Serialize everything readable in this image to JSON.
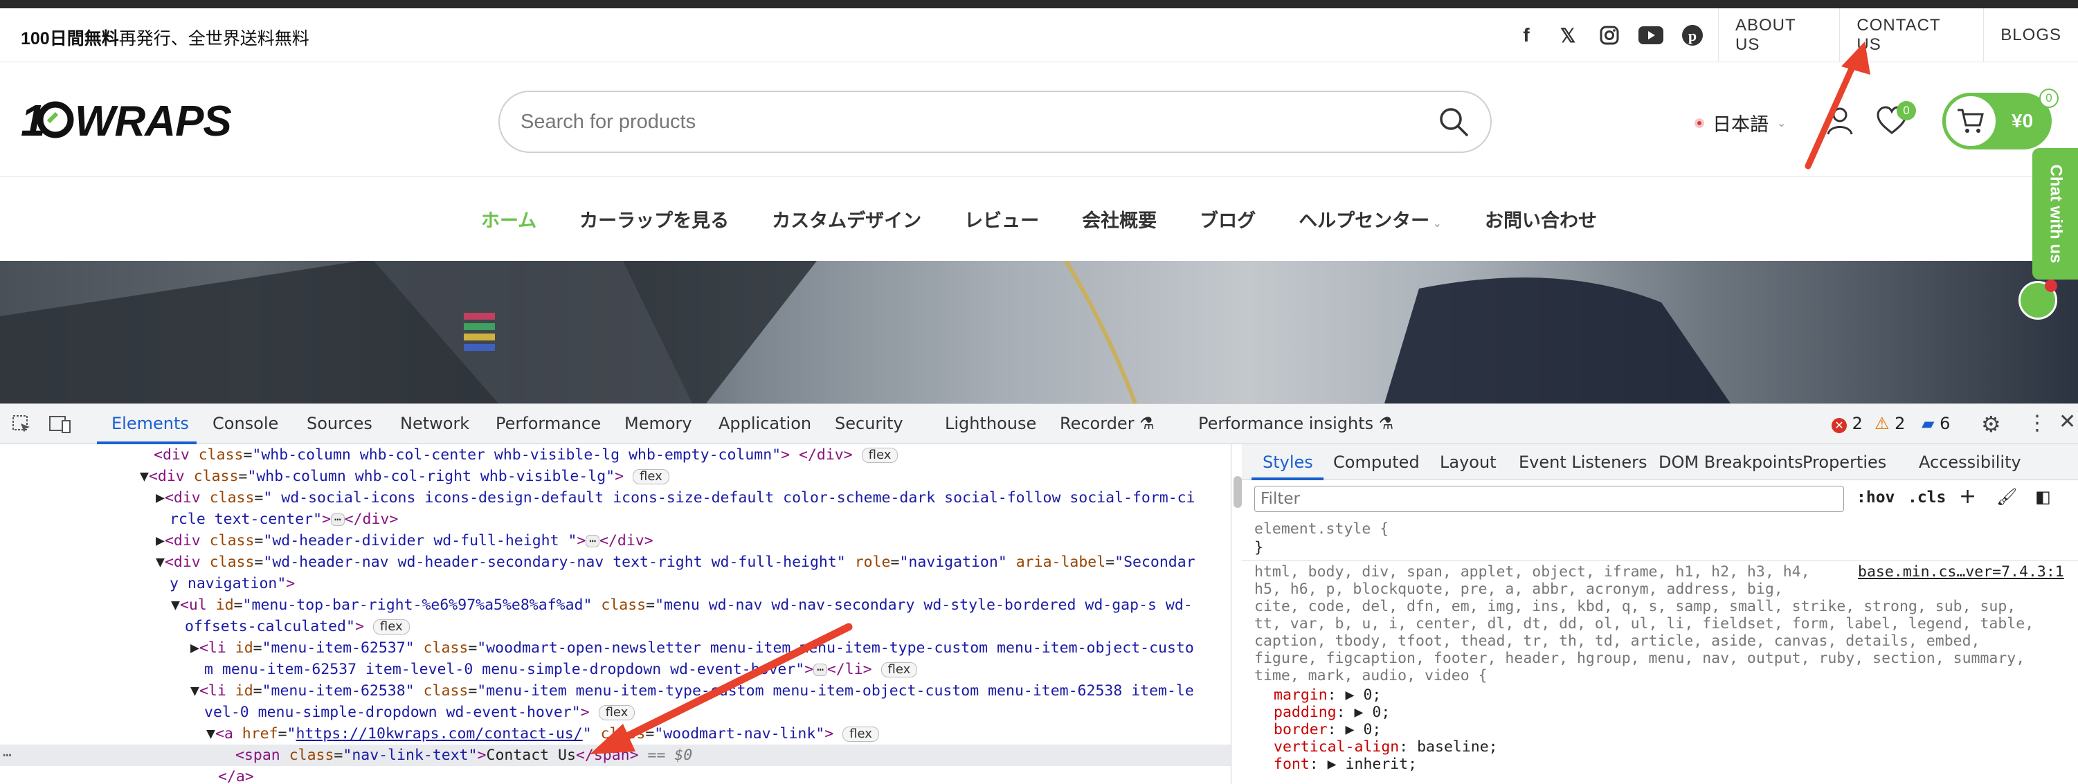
{
  "topbar": {
    "promo_bold": "100日間無料",
    "promo_rest": "再発行、全世界送料無料",
    "nav": [
      "ABOUT US",
      "CONTACT US",
      "BLOGS"
    ],
    "social_icons": [
      "facebook-icon",
      "x-icon",
      "instagram-icon",
      "youtube-icon",
      "pinterest-icon"
    ]
  },
  "header": {
    "logo_text": "10KWRAPS",
    "search_placeholder": "Search for products",
    "language": "日本語",
    "wishlist_count": "0",
    "cart_count": "0",
    "cart_amount": "¥0"
  },
  "mainnav": {
    "items": [
      "ホーム",
      "カーラップを見る",
      "カスタムデザイン",
      "レビュー",
      "会社概要",
      "ブログ",
      "ヘルプセンター",
      "お問い合わせ"
    ],
    "active_index": 0
  },
  "chat": {
    "label": "Chat with us"
  },
  "devtools": {
    "tabs": [
      "Elements",
      "Console",
      "Sources",
      "Network",
      "Performance",
      "Memory",
      "Application",
      "Security",
      "Lighthouse",
      "Recorder",
      "Performance insights"
    ],
    "active_tab": "Elements",
    "errors": "2",
    "warnings": "2",
    "messages": "6",
    "code_lines": [
      "<div class=\"whb-column whb-col-center whb-visible-lg whb-empty-column\"> </div>",
      "<div class=\"whb-column whb-col-right whb-visible-lg\">",
      "<div class=\" wd-social-icons icons-design-default icons-size-default color-scheme-dark social-follow social-form-ci",
      "rcle text-center\">",
      "</div>",
      "<div class=\"wd-header-divider wd-full-height \">",
      "</div>",
      "<div class=\"wd-header-nav wd-header-secondary-nav text-right wd-full-height\" role=\"navigation\" aria-label=\"Secondar",
      "y navigation\">",
      "<ul id=\"menu-top-bar-right-%e6%97%a5%e8%af%ad\" class=\"menu wd-nav wd-nav-secondary wd-style-bordered wd-gap-s wd-",
      "offsets-calculated\">",
      "<li id=\"menu-item-62537\" class=\"woodmart-open-newsletter menu-item menu-item-type-custom menu-item-object-custo",
      "m menu-item-62537 item-level-0 menu-simple-dropdown wd-event-hover\">",
      "</li>",
      "<li id=\"menu-item-62538\" class=\"menu-item menu-item-type-custom menu-item-object-custom menu-item-62538 item-le",
      "vel-0 menu-simple-dropdown wd-event-hover\">",
      "<a href=\"https://10kwraps.com/contact-us/\" class=\"woodmart-nav-link\">",
      "<span class=\"nav-link-text\">Contact Us</span>",
      "== $0",
      "</a>"
    ],
    "href": "https://10kwraps.com/contact-us/",
    "flex_label": "flex",
    "styles_tabs": [
      "Styles",
      "Computed",
      "Layout",
      "Event Listeners",
      "DOM Breakpoints",
      "Properties",
      "Accessibility"
    ],
    "filter_placeholder": "Filter",
    "hov": ":hov",
    "cls": ".cls",
    "element_style": "element.style {",
    "close_brace": "}",
    "selector_lines": [
      "html, body, div, span, applet, object, iframe, h1, h2, h3, h4,",
      "h5, h6, p, blockquote, pre, a, abbr, acronym, address, big,",
      "cite, code, del, dfn, em, img, ins, kbd, q, s, samp, small, strike, strong, sub, sup,",
      "tt, var, b, u, i, center, dl, dt, dd, ol, ul, li, fieldset, form, label, legend, table,",
      "caption, tbody, tfoot, thead, tr, th, td, article, aside, canvas, details, embed,",
      "figure, figcaption, footer, header, hgroup, menu, nav, output, ruby, section, summary,",
      "time, mark, audio, video {"
    ],
    "source_link": "base.min.cs…ver=7.4.3:1",
    "properties": [
      {
        "name": "margin",
        "value": "0;"
      },
      {
        "name": "padding",
        "value": "0;"
      },
      {
        "name": "border",
        "value": "0;"
      },
      {
        "name": "vertical-align",
        "value": "baseline;"
      },
      {
        "name": "font",
        "value": "inherit;"
      }
    ]
  }
}
